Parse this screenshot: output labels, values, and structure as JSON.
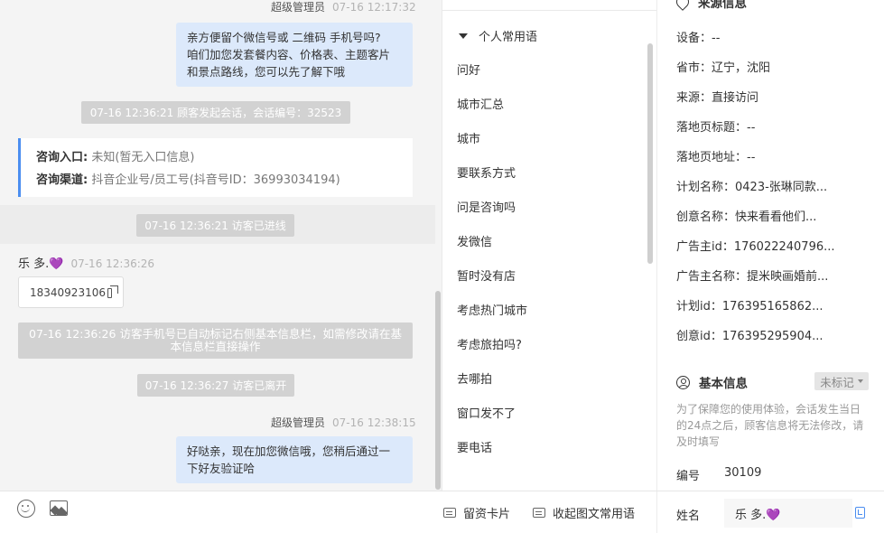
{
  "chat": {
    "top_meta": {
      "sender": "超级管理员",
      "time": "07-16 12:17:32"
    },
    "msg1": [
      "亲方便留个微信号或 二维码 手机号吗?",
      "咱们加您发套餐内容、价格表、主题客片",
      "和景点路线，您可以先了解下哦"
    ],
    "sys1": "07-16 12:36:21 顾客发起会话，会话编号：32523",
    "info_card": {
      "entry_label": "咨询入口:",
      "entry_value": "未知(暂无入口信息)",
      "channel_label": "咨询渠道:",
      "channel_value": "抖音企业号/员工号(抖音号ID：36993034194)"
    },
    "sys2": "07-16 12:36:21 访客已进线",
    "visitor": {
      "name": "乐 多.💜",
      "time": "07-16 12:36:26",
      "phone": "18340923106"
    },
    "sys3": [
      "07-16 12:36:26 访客手机号已自动标记右侧基本信息栏，如需修改请在基",
      "本信息栏直接操作"
    ],
    "sys4": "07-16 12:36:27 访客已离开",
    "bottom_meta": {
      "sender": "超级管理员",
      "time": "07-16 12:38:15"
    },
    "msg2": [
      "好哒亲，现在加您微信哦，您稍后通过一",
      "下好友验证哈"
    ]
  },
  "toolbar": {
    "emoji_icon": "emoji-icon",
    "image_icon": "image-icon",
    "lead_card": "留资卡片",
    "favorite_phrases": "收起图文常用语"
  },
  "phrases": {
    "header": "个人常用语",
    "items": [
      "问好",
      "城市汇总",
      "城市",
      "要联系方式",
      "问是咨询吗",
      "发微信",
      "暂时没有店",
      "考虑热门城市",
      "考虑旅拍吗?",
      "去哪拍",
      "窗口发不了",
      "要电话"
    ]
  },
  "source": {
    "title": "来源信息",
    "rows": [
      "设备：--",
      "省市：辽宁，沈阳",
      "来源：直接访问",
      "落地页标题：--",
      "落地页地址：--",
      "计划名称：0423-张琳同款...",
      "创意名称：快来看看他们...",
      "广告主id：176022240796...",
      "广告主名称：提米映画婚前...",
      "计划id：176395165862...",
      "创意id：176395295904..."
    ]
  },
  "basic": {
    "title": "基本信息",
    "tag": "未标记",
    "note": "为了保障您的使用体验，会话发生当日的24点之后，顾客信息将无法修改，请及时填写",
    "id_label": "编号",
    "id_value": "30109",
    "name_label": "姓名",
    "name_value": "乐 多.💜"
  }
}
